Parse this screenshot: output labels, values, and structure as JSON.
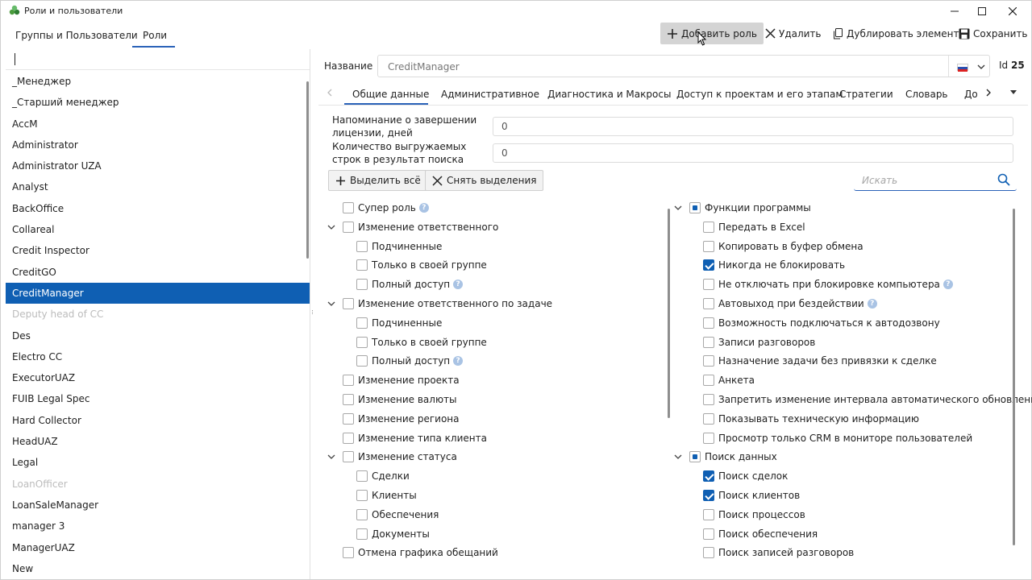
{
  "window": {
    "title": "Роли и пользователи"
  },
  "left_tabs": [
    "Группы и Пользователи",
    "Роли"
  ],
  "toolbar": {
    "add_role": "Добавить роль",
    "delete": "Удалить",
    "duplicate": "Дублировать элемент",
    "save": "Сохранить"
  },
  "roles": [
    "_Менеджер",
    "_Старший менеджер",
    "AccM",
    "Administrator",
    "Administrator UZA",
    "Analyst",
    "BackOffice",
    "Collareal",
    "Credit Inspector",
    "CreditGO",
    "CreditManager",
    "Deputy head of CC",
    "Des",
    "Electro CC",
    "ExecutorUAZ",
    "FUIB Legal Spec",
    "Hard Collector",
    "HeadUAZ",
    "Legal",
    "LoanOfficer",
    "LoanSaleManager",
    "manager 3",
    "ManagerUAZ",
    "New"
  ],
  "selected_role": "CreditManager",
  "disabled_roles": [
    "Deputy head of CC",
    "LoanOfficer"
  ],
  "form": {
    "name_label": "Название",
    "name_value": "CreditManager",
    "id_label": "Id",
    "id_value": "25"
  },
  "tabs": [
    "Общие данные",
    "Административное",
    "Диагностика и Макросы",
    "Доступ к проектам и его этапам",
    "Стратегии",
    "Словарь",
    "До"
  ],
  "fields": [
    {
      "label": "Напоминание о завершении лицензии, дней",
      "value": "0"
    },
    {
      "label": "Количество выгружаемых строк в результат поиска",
      "value": "0"
    }
  ],
  "actions": {
    "select_all": "Выделить всё",
    "clear_selection": "Снять выделения",
    "search_placeholder": "Искать"
  },
  "left_perms": [
    {
      "label": "Супер роль",
      "level": 0,
      "help": true,
      "checked": false
    },
    {
      "label": "Изменение ответственного",
      "level": 0,
      "expandable": true,
      "checked": false
    },
    {
      "label": "Подчиненные",
      "level": 1,
      "checked": false
    },
    {
      "label": "Только в своей группе",
      "level": 1,
      "checked": false
    },
    {
      "label": "Полный доступ",
      "level": 1,
      "help": true,
      "checked": false
    },
    {
      "label": "Изменение ответственного по задаче",
      "level": 0,
      "expandable": true,
      "checked": false
    },
    {
      "label": "Подчиненные",
      "level": 1,
      "checked": false
    },
    {
      "label": "Только в своей группе",
      "level": 1,
      "checked": false
    },
    {
      "label": "Полный доступ",
      "level": 1,
      "help": true,
      "checked": false
    },
    {
      "label": "Изменение проекта",
      "level": 0,
      "checked": false
    },
    {
      "label": "Изменение валюты",
      "level": 0,
      "checked": false
    },
    {
      "label": "Изменение региона",
      "level": 0,
      "checked": false
    },
    {
      "label": "Изменение типа клиента",
      "level": 0,
      "checked": false
    },
    {
      "label": "Изменение статуса",
      "level": 0,
      "expandable": true,
      "checked": false
    },
    {
      "label": "Сделки",
      "level": 1,
      "checked": false
    },
    {
      "label": "Клиенты",
      "level": 1,
      "checked": false
    },
    {
      "label": "Обеспечения",
      "level": 1,
      "checked": false
    },
    {
      "label": "Документы",
      "level": 1,
      "checked": false
    },
    {
      "label": "Отмена графика обещаний",
      "level": 0,
      "checked": false
    }
  ],
  "right_perms": [
    {
      "label": "Функции программы",
      "level": 0,
      "expandable": true,
      "state": "partial"
    },
    {
      "label": "Передать в Excel",
      "level": 1,
      "state": "none"
    },
    {
      "label": "Копировать в буфер обмена",
      "level": 1,
      "state": "none"
    },
    {
      "label": "Никогда не блокировать",
      "level": 1,
      "state": "checked"
    },
    {
      "label": "Не отключать при блокировке компьютера",
      "level": 1,
      "help": true,
      "state": "none"
    },
    {
      "label": "Автовыход при бездействии",
      "level": 1,
      "help": true,
      "state": "none"
    },
    {
      "label": "Возможность подключаться к автодозвону",
      "level": 1,
      "state": "none"
    },
    {
      "label": "Записи разговоров",
      "level": 1,
      "state": "none"
    },
    {
      "label": "Назначение задачи без привязки к сделке",
      "level": 1,
      "state": "none"
    },
    {
      "label": "Анкета",
      "level": 1,
      "state": "none"
    },
    {
      "label": "Запретить изменение интервала автоматического обновления",
      "level": 1,
      "state": "none"
    },
    {
      "label": "Показывать техническую информацию",
      "level": 1,
      "state": "none"
    },
    {
      "label": "Просмотр только CRM в мониторе пользователей",
      "level": 1,
      "state": "none"
    },
    {
      "label": "Поиск данных",
      "level": 0,
      "expandable": true,
      "state": "partial"
    },
    {
      "label": "Поиск сделок",
      "level": 1,
      "state": "checked"
    },
    {
      "label": "Поиск клиентов",
      "level": 1,
      "state": "checked"
    },
    {
      "label": "Поиск процессов",
      "level": 1,
      "state": "none"
    },
    {
      "label": "Поиск обеспечения",
      "level": 1,
      "state": "none"
    },
    {
      "label": "Поиск записей разговоров",
      "level": 1,
      "state": "none"
    }
  ]
}
